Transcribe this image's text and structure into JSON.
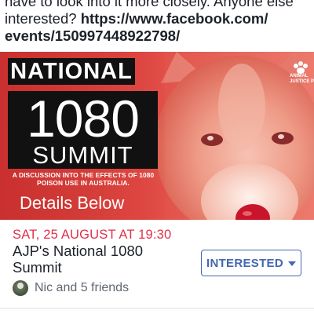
{
  "post": {
    "line1": "have to look into it more closely. Anyone else",
    "line2_prefix": "interested? ",
    "line2_link": "https://www.facebook.com/",
    "line3_link": "events/150997448922798/"
  },
  "banner": {
    "national": "NATIONAL",
    "number": "1080",
    "summit": "SUMMIT",
    "subtitle": "A DISCUSSION INTO THE EFFECTS OF 1080 POISON USE IN AUSTRALIA.",
    "details": "Details Below",
    "logo_text": "ANIMAL JUSTICE PA",
    "colors": {
      "red": "#d63a37",
      "black": "#111111"
    }
  },
  "event": {
    "date": "SAT, 25 AUGUST AT 19:30",
    "title": "AJP's National 1080 Summit",
    "interested_label": "INTERESTED",
    "friends_text": "Nic and 5 friends",
    "colors": {
      "date": "#e0304b",
      "button": "#4267b2"
    }
  },
  "icons": {
    "caret": "chevron-down-icon",
    "avatar": "friend-avatar",
    "logo": "paw-logo-icon"
  }
}
